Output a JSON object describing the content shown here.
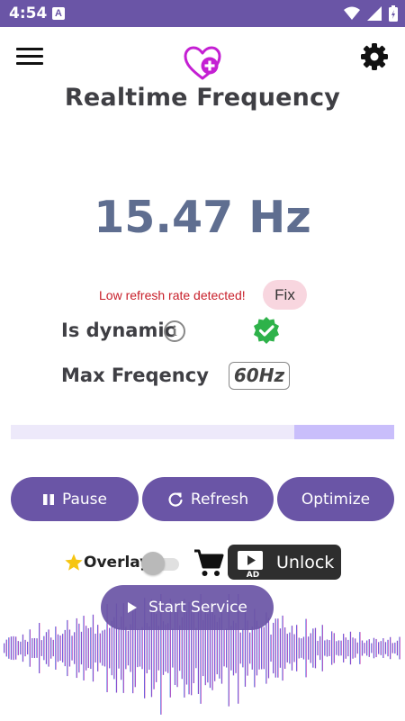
{
  "status_bar": {
    "time": "4:54",
    "notification_letter": "A"
  },
  "header": {
    "title": "Realtime Frequency",
    "menu_icon": "hamburger-icon",
    "settings_icon": "gear-icon",
    "logo_icon": "heart-plus-icon"
  },
  "frequency": {
    "value": "15.47 Hz"
  },
  "warning": {
    "text": "Low refresh rate detected!",
    "fix_label": "Fix"
  },
  "dynamic": {
    "label": "Is dynamic",
    "info_symbol": "i",
    "status_icon": "verified-check-icon"
  },
  "max_frequency": {
    "label": "Max Freqency",
    "value": "60Hz"
  },
  "progress": {
    "fraction": 0.26
  },
  "actions": {
    "pause_label": "Pause",
    "refresh_label": "Refresh",
    "optimize_label": "Optimize"
  },
  "overlay": {
    "label": "Overlay",
    "enabled": false
  },
  "unlock": {
    "label": "Unlock",
    "badge": "AD"
  },
  "start": {
    "label": "Start Service"
  },
  "colors": {
    "primary": "#6a55a6",
    "status_bar": "#6a55a6",
    "warning": "#c8202b",
    "fix_bg": "#f8d6df",
    "verified": "#2eb24a",
    "progress_bg": "#ede9fa",
    "progress_fill": "#c9befb",
    "logo": "#c41fd3"
  }
}
